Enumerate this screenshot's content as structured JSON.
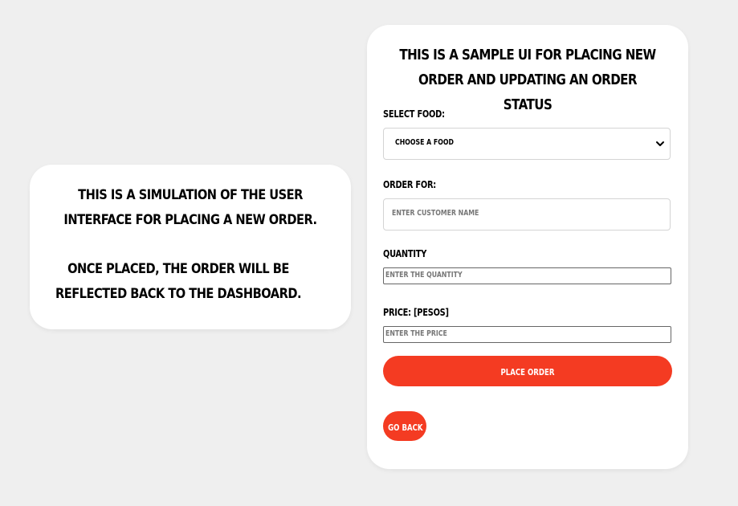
{
  "info_card": {
    "paragraph_1": "This is a simulation of the user interface for placing a new order.",
    "paragraph_2": "Once placed, the order will be reflected back to the dashboard."
  },
  "form": {
    "title": "This is a sample UI for placing new order and updating an order status",
    "select_food_label": "Select Food:",
    "select_food_value": "Choose a Food",
    "order_for_label": "Order For:",
    "order_for_placeholder": "Enter Customer Name",
    "quantity_label": "Quantity",
    "quantity_placeholder": "Enter the quantity",
    "price_label": "Price: [Pesos]",
    "price_placeholder": "Enter the price",
    "place_order_label": "Place Order",
    "go_back_label": "Go Back"
  },
  "colors": {
    "accent": "#f43b22",
    "background": "#efefef",
    "card": "#ffffff"
  },
  "icons": {
    "select_chevron": "chevron-down-icon"
  }
}
